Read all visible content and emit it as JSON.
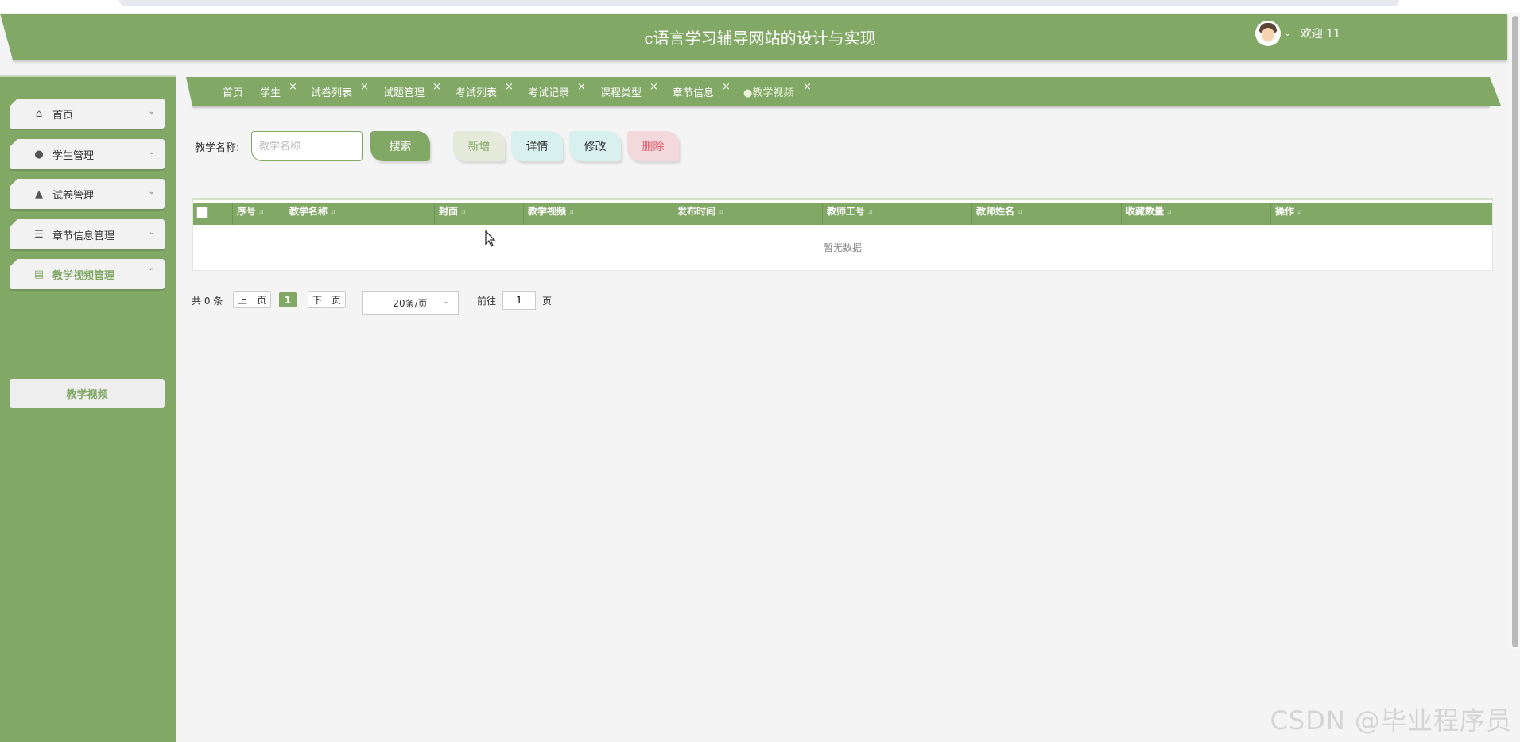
{
  "header": {
    "title": "c语言学习辅导网站的设计与实现",
    "welcome": "欢迎 11"
  },
  "sidebar": {
    "items": [
      {
        "label": "首页",
        "icon": "home-icon"
      },
      {
        "label": "学生管理",
        "icon": "user-icon"
      },
      {
        "label": "试卷管理",
        "icon": "drop-icon"
      },
      {
        "label": "章节信息管理",
        "icon": "list-icon"
      },
      {
        "label": "教学视频管理",
        "icon": "archive-icon"
      }
    ],
    "subitem": "教学视频"
  },
  "tabs": [
    {
      "label": "首页",
      "closable": false
    },
    {
      "label": "学生",
      "closable": true
    },
    {
      "label": "试卷列表",
      "closable": true
    },
    {
      "label": "试题管理",
      "closable": true
    },
    {
      "label": "考试列表",
      "closable": true
    },
    {
      "label": "考试记录",
      "closable": true
    },
    {
      "label": "课程类型",
      "closable": true
    },
    {
      "label": "章节信息",
      "closable": true
    },
    {
      "label": "●教学视频",
      "closable": true,
      "active": true
    }
  ],
  "search": {
    "label": "教学名称:",
    "placeholder": "教学名称",
    "value": "",
    "button": "搜索"
  },
  "actions": {
    "add": "新增",
    "detail": "详情",
    "edit": "修改",
    "delete": "删除"
  },
  "table": {
    "columns": [
      "序号",
      "教学名称",
      "封面",
      "教学视频",
      "发布时间",
      "教师工号",
      "教师姓名",
      "收藏数量",
      "操作"
    ],
    "rows": [],
    "empty_text": "暂无数据"
  },
  "pagination": {
    "total": "共 0 条",
    "prev": "上一页",
    "current": "1",
    "next": "下一页",
    "page_size": "20条/页",
    "goto_label": "前往",
    "goto_value": "1",
    "page_unit": "页"
  },
  "watermark": "CSDN @毕业程序员",
  "colors": {
    "primary": "#82a866",
    "danger": "#e05a6c",
    "info_bg": "#d8f1ee"
  }
}
